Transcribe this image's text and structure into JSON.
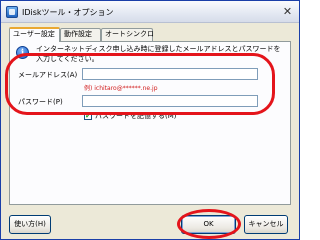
{
  "window": {
    "title": "IDiskツール・オプション",
    "close_glyph": "✕"
  },
  "tabs": [
    {
      "label": "ユーザー設定",
      "active": true
    },
    {
      "label": "動作設定",
      "active": false
    },
    {
      "label": "オートシンクロ",
      "active": false
    }
  ],
  "info": {
    "icon_glyph": "i",
    "text": "インターネットディスク申し込み時に登録したメールアドレスとパスワードを入力してください。"
  },
  "form": {
    "email_label": "メールアドレス(A)",
    "email_value": "",
    "email_example": "例) ichitaro@******.ne.jp",
    "password_label": "パスワード(P)",
    "password_value": "",
    "remember_label": "パスワードを記憶する(M)",
    "remember_checked": true,
    "check_glyph": "✔"
  },
  "buttons": {
    "help_label": "使い方(H)",
    "ok_label": "OK",
    "cancel_label": "キャンセル"
  },
  "colors": {
    "highlight": "#e4141b",
    "example_text": "#d11b1b",
    "dialog_bg": "#ece9d8",
    "panel_bg": "#fcfcfe",
    "active_tab_accent": "#e9a832"
  }
}
